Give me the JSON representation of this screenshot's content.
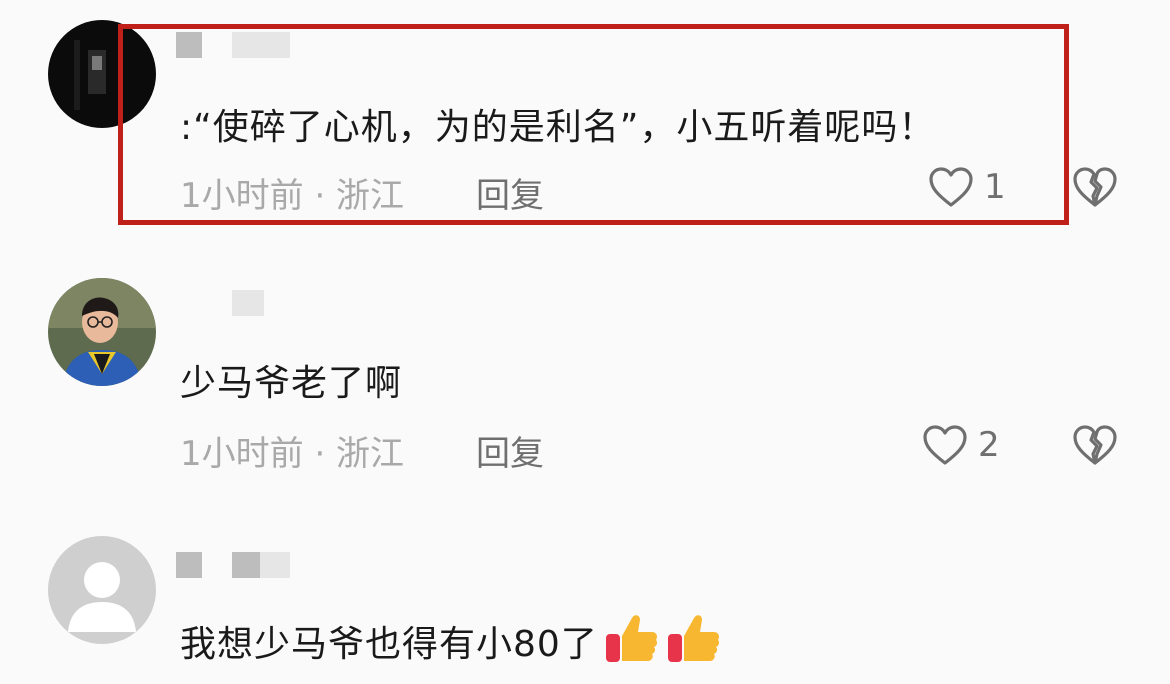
{
  "comments": [
    {
      "text": ":“使碎了心机，为的是利名”，小五听着呢吗！",
      "meta": "1小时前 · 浙江",
      "reply": "回复",
      "likes": "1",
      "highlighted": true
    },
    {
      "text": "少马爷老了啊",
      "meta": "1小时前 · 浙江",
      "reply": "回复",
      "likes": "2"
    },
    {
      "text": "我想少马爷也得有小80了",
      "emoji": [
        "thumbs-up",
        "thumbs-up"
      ]
    }
  ],
  "icons": {
    "like": "heart-outline-icon",
    "dislike": "broken-heart-icon"
  },
  "colors": {
    "highlight_border": "#c0201a",
    "background": "#fafafa",
    "meta_text": "#a9a9a9"
  }
}
